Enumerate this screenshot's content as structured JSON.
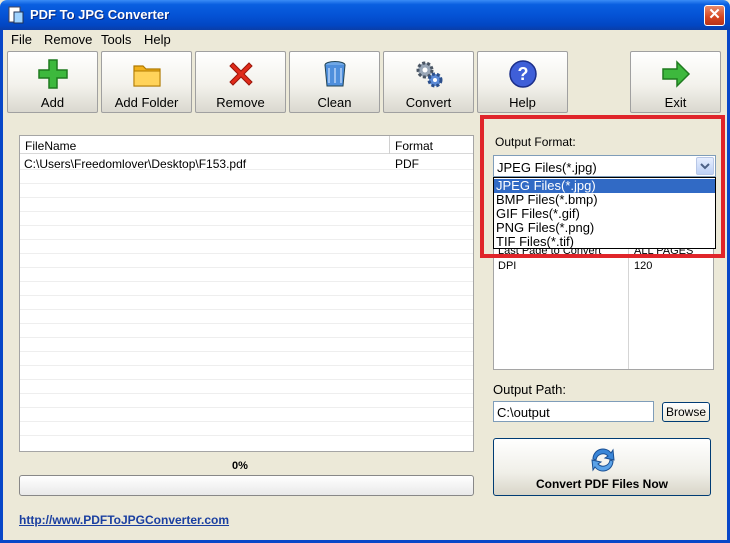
{
  "window": {
    "title": "PDF To JPG Converter",
    "close_glyph": "✕"
  },
  "menu": [
    "File",
    "Remove",
    "Tools",
    "Help"
  ],
  "toolbar": {
    "add": "Add",
    "add_folder": "Add Folder",
    "remove": "Remove",
    "clean": "Clean",
    "convert": "Convert",
    "help": "Help",
    "exit": "Exit"
  },
  "file_list": {
    "columns": [
      "FileName",
      "Format"
    ],
    "rows": [
      {
        "filename": "C:\\Users\\Freedomlover\\Desktop\\F153.pdf",
        "format": "PDF"
      }
    ]
  },
  "progress": {
    "label": "0%",
    "value": 0
  },
  "website_link": "http://www.PDFToJPGConverter.com",
  "output_format": {
    "label": "Output Format:",
    "selected": "JPEG Files(*.jpg)",
    "options": [
      "JPEG Files(*.jpg)",
      "BMP Files(*.bmp)",
      "GIF Files(*.gif)",
      "PNG Files(*.png)",
      "TIF Files(*.tif)"
    ]
  },
  "properties": [
    {
      "name": "Last Page to Convert",
      "value": "ALL PAGES"
    },
    {
      "name": "DPI",
      "value": "120"
    }
  ],
  "output_path": {
    "label": "Output Path:",
    "value": "C:\\output",
    "browse": "Browse"
  },
  "convert_now": "Convert PDF Files Now",
  "colors": {
    "title_bar": "#0453d6",
    "highlight_box": "#e0252a",
    "selected_option": "#316ac5",
    "link": "#1a3fa0"
  }
}
